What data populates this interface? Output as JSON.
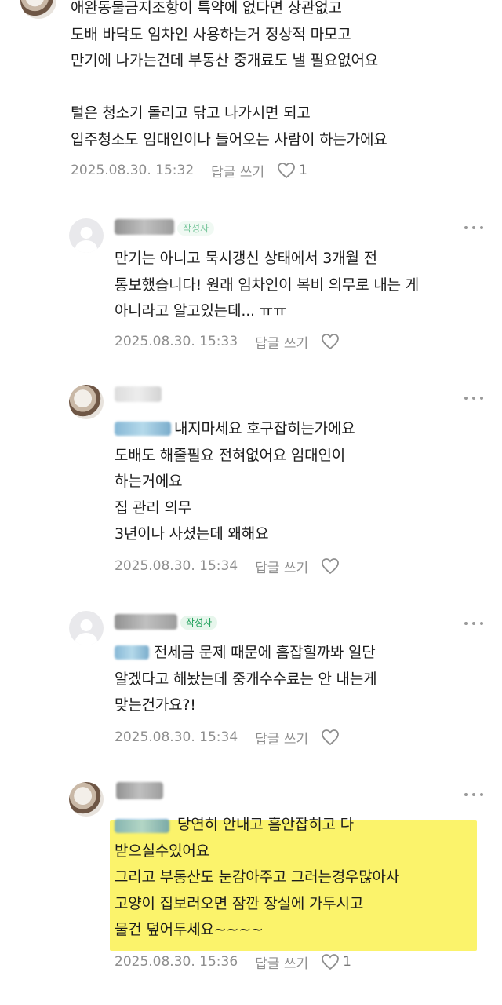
{
  "comments": [
    {
      "text": "애완동물금지조항이 특약에 없다면 상관없고\n도배 바닥도 임차인 사용하는거 정상적 마모고\n만기에 나가는건데 부동산 중개료도 낼 필요없어요\n\n털은 청소기 돌리고 닦고 나가시면 되고\n입주청소도 임대인이나 들어오는 사람이 하는가에요",
      "date": "2025.08.30. 15:32",
      "reply_label": "답글 쓰기",
      "likes": "1"
    },
    {
      "badge": "작성자",
      "text": "만기는 아니고 묵시갱신 상태에서 3개월 전\n통보했습니다! 원래 임차인이 복비 의무로 내는 게\n아니라고 알고있는데... ㅠㅠ",
      "date": "2025.08.30. 15:33",
      "reply_label": "답글 쓰기"
    },
    {
      "text": "내지마세요 호구잡히는가에요\n도배도 해줄필요 전혀없어요 임대인이\n하는거에요\n집 관리 의무\n3년이나 사셨는데 왜해요",
      "date": "2025.08.30. 15:34",
      "reply_label": "답글 쓰기"
    },
    {
      "badge": "작성자",
      "text": "전세금 문제 때문에 흠잡힐까봐 일단\n알겠다고 해놨는데 중개수수료는 안 내는게\n맞는건가요?!",
      "date": "2025.08.30. 15:34",
      "reply_label": "답글 쓰기"
    },
    {
      "text": "당연히 안내고 흠안잡히고 다\n받으실수있어요\n그리고 부동산도 눈감아주고 그러는경우많아사\n고양이 집보러오면 잠깐 장실에 가두시고\n물건 덮어두세요~~~~",
      "date": "2025.08.30. 15:36",
      "reply_label": "답글 쓰기",
      "likes": "1"
    }
  ],
  "colors": {
    "accent_badge": "#1ea05a",
    "highlight": "#fbf36b",
    "meta_text": "#8e8e8e"
  },
  "icons": [
    "heart-icon",
    "more-options-icon",
    "avatar-placeholder-icon"
  ]
}
